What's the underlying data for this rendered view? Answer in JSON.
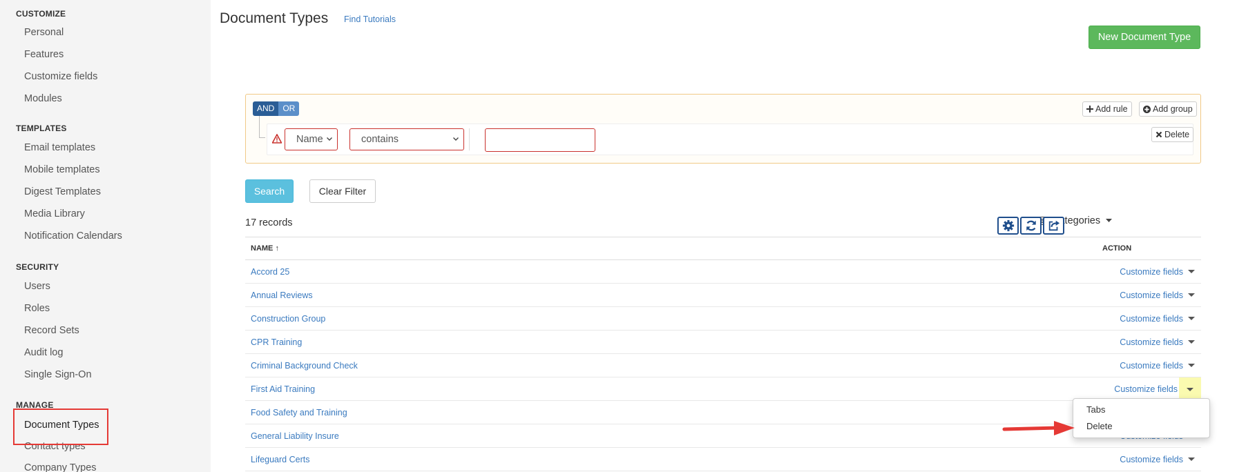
{
  "sidebar": {
    "sections": [
      {
        "title": "CUSTOMIZE",
        "items": [
          "Personal",
          "Features",
          "Customize fields",
          "Modules"
        ]
      },
      {
        "title": "TEMPLATES",
        "items": [
          "Email templates",
          "Mobile templates",
          "Digest Templates",
          "Media Library",
          "Notification Calendars"
        ]
      },
      {
        "title": "SECURITY",
        "items": [
          "Users",
          "Roles",
          "Record Sets",
          "Audit log",
          "Single Sign-On"
        ]
      },
      {
        "title": "MANAGE",
        "items": [
          "Document Types",
          "Contact types",
          "Company Types"
        ]
      }
    ],
    "active_item": "Document Types"
  },
  "header": {
    "title": "Document Types",
    "tutorials_link": "Find Tutorials",
    "new_button": "New Document Type"
  },
  "filter": {
    "and_label": "AND",
    "or_label": "OR",
    "add_rule": "Add rule",
    "add_group": "Add group",
    "field_value": "Name",
    "operator_value": "contains",
    "text_value": "",
    "delete_label": "Delete"
  },
  "actions": {
    "search": "Search",
    "clear": "Clear Filter"
  },
  "list": {
    "records": "17 records",
    "categories": "Categories",
    "col_name": "NAME ↑",
    "col_action": "ACTION",
    "rows": [
      {
        "name": "Accord 25",
        "action": "Customize fields"
      },
      {
        "name": "Annual Reviews",
        "action": "Customize fields"
      },
      {
        "name": "Construction Group",
        "action": "Customize fields"
      },
      {
        "name": "CPR Training",
        "action": "Customize fields"
      },
      {
        "name": "Criminal Background Check",
        "action": "Customize fields"
      },
      {
        "name": "First Aid Training",
        "action": "Customize fields"
      },
      {
        "name": "Food Safety and Training",
        "action": ""
      },
      {
        "name": "General Liability Insure",
        "action": "Customize fields"
      },
      {
        "name": "Lifeguard Certs",
        "action": "Customize fields"
      }
    ]
  },
  "dropdown": {
    "items": [
      "Tabs",
      "Delete"
    ]
  },
  "colors": {
    "primary_green": "#5cb85c",
    "search_blue": "#5bc0de",
    "link_blue": "#3a7abf",
    "highlight_red": "#e53935"
  }
}
